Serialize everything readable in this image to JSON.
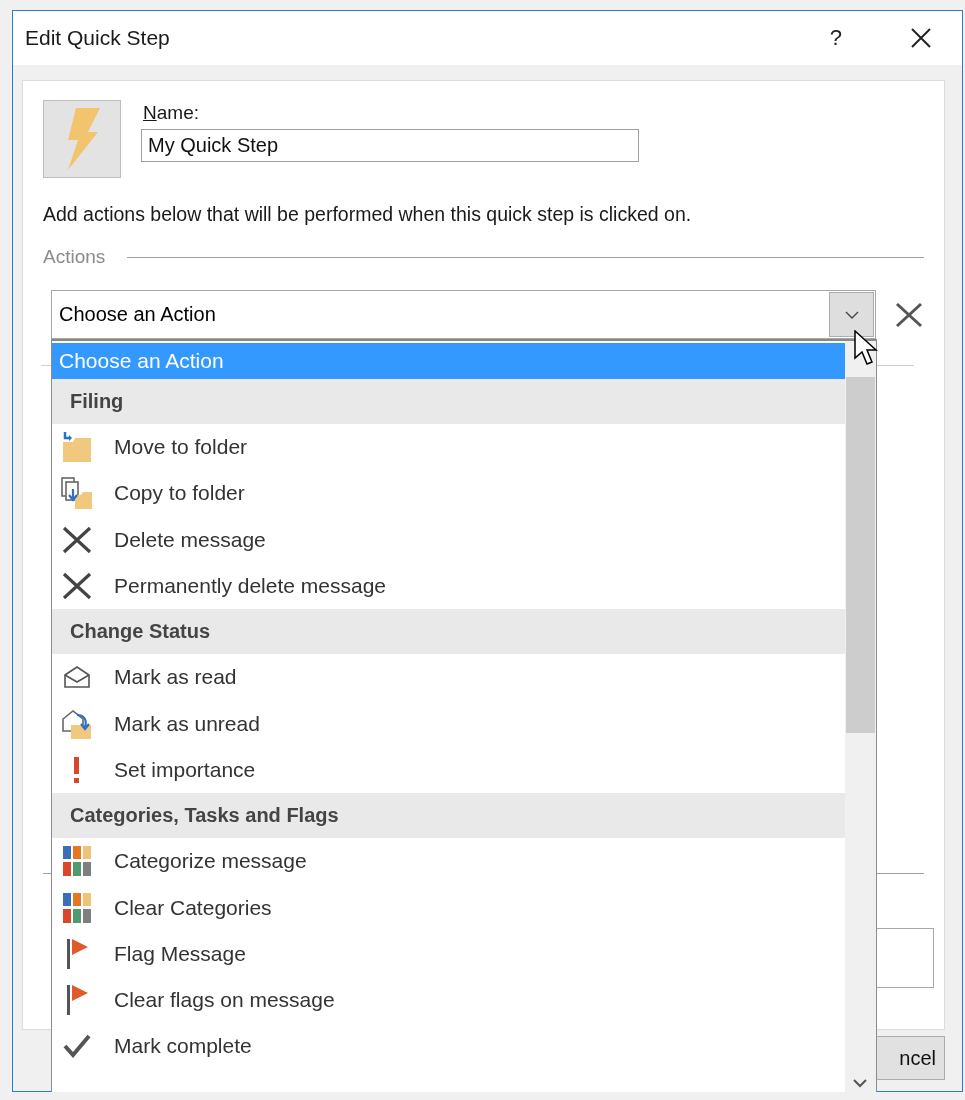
{
  "window": {
    "title": "Edit Quick Step",
    "help_button": "?"
  },
  "quick_step": {
    "name_label": "Name:",
    "name_value": "My Quick Step"
  },
  "instructions": "Add actions below that will be performed when this quick step is clicked on.",
  "actions_heading": "Actions",
  "action_select": {
    "value": "Choose an Action"
  },
  "dropdown": {
    "options": [
      {
        "kind": "option",
        "label": "Choose an Action",
        "selected": true
      },
      {
        "kind": "header",
        "label": "Filing"
      },
      {
        "kind": "option",
        "label": "Move to folder",
        "selected": false
      },
      {
        "kind": "option",
        "label": "Copy to folder",
        "selected": false
      },
      {
        "kind": "option",
        "label": "Delete message",
        "selected": false
      },
      {
        "kind": "option",
        "label": "Permanently delete message",
        "selected": false
      },
      {
        "kind": "header",
        "label": "Change Status"
      },
      {
        "kind": "option",
        "label": "Mark as read",
        "selected": false
      },
      {
        "kind": "option",
        "label": "Mark as unread",
        "selected": false
      },
      {
        "kind": "option",
        "label": "Set importance",
        "selected": false
      },
      {
        "kind": "header",
        "label": "Categories, Tasks and Flags"
      },
      {
        "kind": "option",
        "label": "Categorize message",
        "selected": false
      },
      {
        "kind": "option",
        "label": "Clear Categories",
        "selected": false
      },
      {
        "kind": "option",
        "label": "Flag Message",
        "selected": false
      },
      {
        "kind": "option",
        "label": "Clear flags on message",
        "selected": false
      },
      {
        "kind": "option",
        "label": "Mark complete",
        "selected": false
      }
    ]
  },
  "buttons": [
    "ncel"
  ]
}
